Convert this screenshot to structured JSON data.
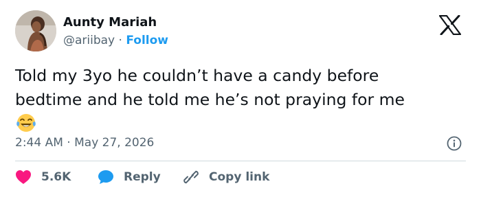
{
  "author": {
    "name": "Aunty Mariah",
    "handle": "@ariibay",
    "separator": "·",
    "follow_label": "Follow"
  },
  "tweet": {
    "line1": "Told my 3yo he couldn’t have a candy before",
    "line2": "bedtime and he told me he’s not praying for me",
    "emoji": "😂"
  },
  "meta": {
    "time": "2:44 AM",
    "separator": "·",
    "date": "May 27, 2026"
  },
  "actions": {
    "like_count": "5.6K",
    "reply_label": "Reply",
    "copy_label": "Copy link"
  },
  "icons": {
    "brand": "x-logo-icon",
    "info": "info-icon",
    "like": "heart-icon",
    "reply": "speech-bubble-icon",
    "copy": "link-icon"
  },
  "colors": {
    "accent": "#1d9bf0",
    "heart": "#f91880",
    "text": "#0f1419",
    "secondary": "#536471",
    "divider": "#cfd9de"
  }
}
